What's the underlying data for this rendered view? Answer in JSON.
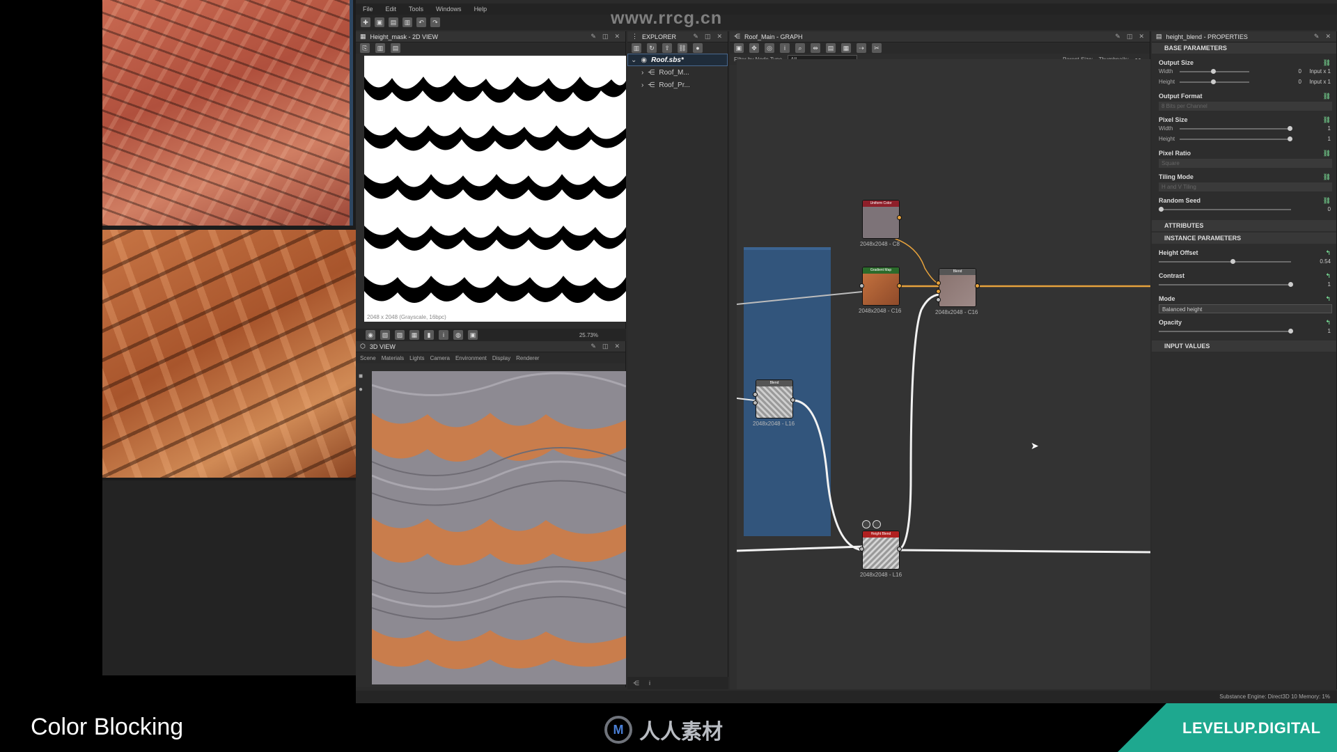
{
  "watermark": "www.rrcg.cn",
  "menu": [
    "File",
    "Edit",
    "Tools",
    "Windows",
    "Help"
  ],
  "view2d": {
    "title": "Height_mask - 2D VIEW",
    "status": "2048 x 2048 (Grayscale, 16bpc)",
    "zoom": "25.73%"
  },
  "view3d": {
    "title": "3D VIEW",
    "menu": [
      "Scene",
      "Materials",
      "Lights",
      "Camera",
      "Environment",
      "Display",
      "Renderer"
    ]
  },
  "explorer": {
    "title": "EXPLORER",
    "root": "Roof.sbs*",
    "children": [
      "Roof_M...",
      "Roof_Pr..."
    ]
  },
  "graph": {
    "title": "Roof_Main - GRAPH",
    "filter_label": "Filter by Node Type",
    "filter_value": "All",
    "parent_size_label": "Parent Size:",
    "thumbnails_label": "Thumbnails:",
    "nodes": [
      {
        "title": "Uniform Color",
        "caption": "2048x2048 - C8"
      },
      {
        "title": "Gradient Map",
        "caption": "2048x2048 - C16"
      },
      {
        "title": "Blend",
        "caption": "2048x2048 - C16"
      },
      {
        "title": "Blend",
        "caption": "2048x2048 - L16"
      },
      {
        "title": "Height Blend",
        "caption": "2048x2048 - L16"
      }
    ]
  },
  "properties": {
    "title": "height_blend - PROPERTIES",
    "base_section": "BASE PARAMETERS",
    "output_size": "Output Size",
    "width": "Width",
    "height": "Height",
    "output_size_width_value": "0",
    "output_size_height_value": "0",
    "output_size_width_mode": "Input x 1",
    "output_size_height_mode": "Input x 1",
    "output_format": "Output Format",
    "output_format_value": "8 Bits per Channel",
    "pixel_size": "Pixel Size",
    "pixel_width_value": "1",
    "pixel_height_value": "1",
    "pixel_ratio": "Pixel Ratio",
    "pixel_ratio_value": "Square",
    "tiling_mode": "Tiling Mode",
    "tiling_mode_value": "H and V Tiling",
    "random_seed": "Random Seed",
    "random_seed_value": "0",
    "attributes_section": "ATTRIBUTES",
    "instance_section": "INSTANCE PARAMETERS",
    "height_offset": "Height Offset",
    "height_offset_value": "0.54",
    "contrast": "Contrast",
    "contrast_value": "1",
    "mode": "Mode",
    "mode_value": "Balanced height",
    "opacity": "Opacity",
    "opacity_value": "1",
    "input_section": "INPUT VALUES"
  },
  "statusbar": "Substance Engine: Direct3D 10  Memory: 1%",
  "caption": "Color Blocking",
  "brand": "LEVELUP.DIGITAL",
  "logo_text": "人人素材",
  "colors": {
    "brand": "#1ea88f",
    "frame": "#32557c",
    "wire_orange": "#e6a23c",
    "wire_white": "#f2f2f2"
  }
}
